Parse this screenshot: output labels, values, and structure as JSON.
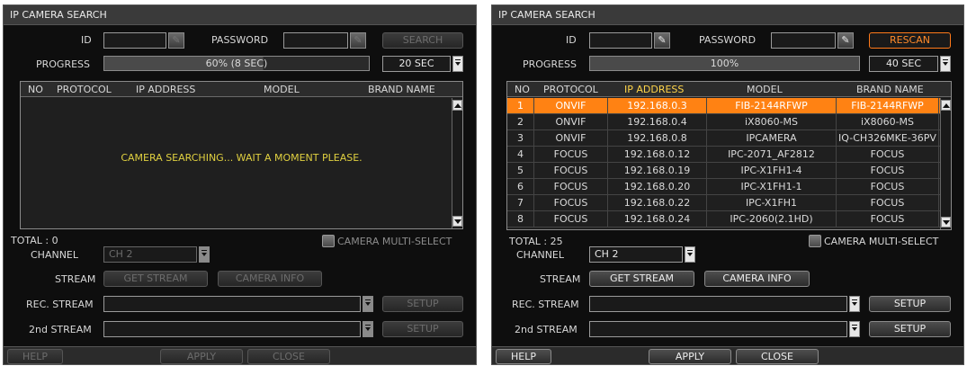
{
  "colors": {
    "accent": "#ff8213",
    "highlight_header": "#ffd54a",
    "status_yellow": "#e0d040",
    "background": "#0e0e0e"
  },
  "left": {
    "title": "IP CAMERA SEARCH",
    "id_label": "ID",
    "id_value": "",
    "password_label": "PASSWORD",
    "password_value": "",
    "key_icon": "key-icon",
    "search_button": "SEARCH",
    "progress_label": "PROGRESS",
    "progress_percent": 60,
    "progress_text": "60% (8 SEC)",
    "timeout": "20 SEC",
    "columns": [
      "NO",
      "PROTOCOL",
      "IP ADDRESS",
      "MODEL",
      "BRAND NAME"
    ],
    "message": "CAMERA SEARCHING... WAIT A MOMENT PLEASE.",
    "total": "TOTAL : 0",
    "multiselect": "CAMERA MULTI-SELECT",
    "channel_label": "CHANNEL",
    "channel_value": "CH 2",
    "stream_label": "STREAM",
    "get_stream": "GET STREAM",
    "camera_info": "CAMERA INFO",
    "rec_stream_label": "REC. STREAM",
    "rec_stream_value": "",
    "second_stream_label": "2nd STREAM",
    "second_stream_value": "",
    "setup": "SETUP",
    "help": "HELP",
    "apply": "APPLY",
    "close": "CLOSE"
  },
  "right": {
    "title": "IP CAMERA SEARCH",
    "id_label": "ID",
    "id_value": "",
    "password_label": "PASSWORD",
    "password_value": "",
    "key_icon": "key-icon",
    "rescan_button": "RESCAN",
    "progress_label": "PROGRESS",
    "progress_percent": 100,
    "progress_text": "100%",
    "timeout": "40 SEC",
    "columns": [
      "NO",
      "PROTOCOL",
      "IP ADDRESS",
      "MODEL",
      "BRAND NAME"
    ],
    "rows": [
      {
        "no": "1",
        "protocol": "ONVIF",
        "ip": "192.168.0.3",
        "model": "FIB-2144RFWP",
        "brand": "FIB-2144RFWP",
        "selected": true
      },
      {
        "no": "2",
        "protocol": "ONVIF",
        "ip": "192.168.0.4",
        "model": "iX8060-MS",
        "brand": "iX8060-MS"
      },
      {
        "no": "3",
        "protocol": "ONVIF",
        "ip": "192.168.0.8",
        "model": "IPCAMERA",
        "brand": "IQ-CH326MKE-36PV"
      },
      {
        "no": "4",
        "protocol": "FOCUS",
        "ip": "192.168.0.12",
        "model": "IPC-2071_AF2812",
        "brand": "FOCUS"
      },
      {
        "no": "5",
        "protocol": "FOCUS",
        "ip": "192.168.0.19",
        "model": "IPC-X1FH1-4",
        "brand": "FOCUS"
      },
      {
        "no": "6",
        "protocol": "FOCUS",
        "ip": "192.168.0.20",
        "model": "IPC-X1FH1-1",
        "brand": "FOCUS"
      },
      {
        "no": "7",
        "protocol": "FOCUS",
        "ip": "192.168.0.22",
        "model": "IPC-X1FH1",
        "brand": "FOCUS"
      },
      {
        "no": "8",
        "protocol": "FOCUS",
        "ip": "192.168.0.24",
        "model": "IPC-2060(2.1HD)",
        "brand": "FOCUS"
      }
    ],
    "total": "TOTAL : 25",
    "multiselect": "CAMERA MULTI-SELECT",
    "channel_label": "CHANNEL",
    "channel_value": "CH 2",
    "stream_label": "STREAM",
    "get_stream": "GET STREAM",
    "camera_info": "CAMERA INFO",
    "rec_stream_label": "REC. STREAM",
    "rec_stream_value": "",
    "second_stream_label": "2nd STREAM",
    "second_stream_value": "",
    "setup": "SETUP",
    "help": "HELP",
    "apply": "APPLY",
    "close": "CLOSE"
  }
}
